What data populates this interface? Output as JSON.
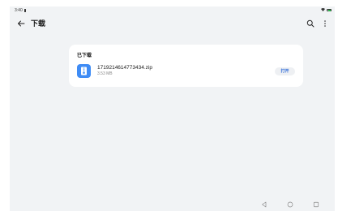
{
  "status_bar": {
    "time": "3:40"
  },
  "app_bar": {
    "title": "下载",
    "icons": [
      "back-arrow-icon",
      "search-icon",
      "more-icon"
    ]
  },
  "downloads": {
    "section_title": "已下载",
    "items": [
      {
        "file_name": "1719214614773434.zip",
        "file_size": "3.53 MB",
        "action_label": "打开",
        "icon": "zip-file-icon"
      }
    ]
  },
  "nav_bar": {
    "icons": [
      "nav-back-icon",
      "nav-home-icon",
      "nav-recents-icon"
    ]
  },
  "colors": {
    "background": "#f1f3f5",
    "card": "#ffffff",
    "file_icon": "#3f8cf5",
    "accent": "#2e6bd8"
  }
}
